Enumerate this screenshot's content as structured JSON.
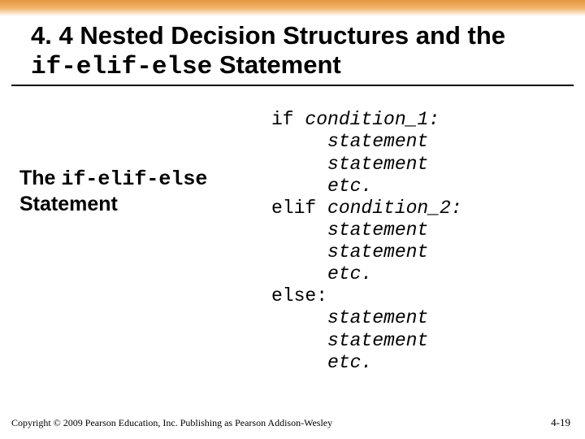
{
  "title": {
    "section": "4. 4 Nested Decision Structures and the ",
    "code": "if-elif-else",
    "suffix": " Statement"
  },
  "subhead": {
    "prefix": "The ",
    "code": "if-elif-else",
    "suffix": "Statement"
  },
  "code": {
    "l01a": "if ",
    "l01b": "condition_1:",
    "l02": "statement",
    "l03": "statement",
    "l04": "etc.",
    "l05a": "elif ",
    "l05b": "condition_2:",
    "l06": "statement",
    "l07": "statement",
    "l08": "etc.",
    "l09": "else:",
    "l10": "statement",
    "l11": "statement",
    "l12": "etc."
  },
  "footer": "Copyright © 2009 Pearson Education, Inc. Publishing as Pearson Addison-Wesley",
  "pagenum": "4-19"
}
